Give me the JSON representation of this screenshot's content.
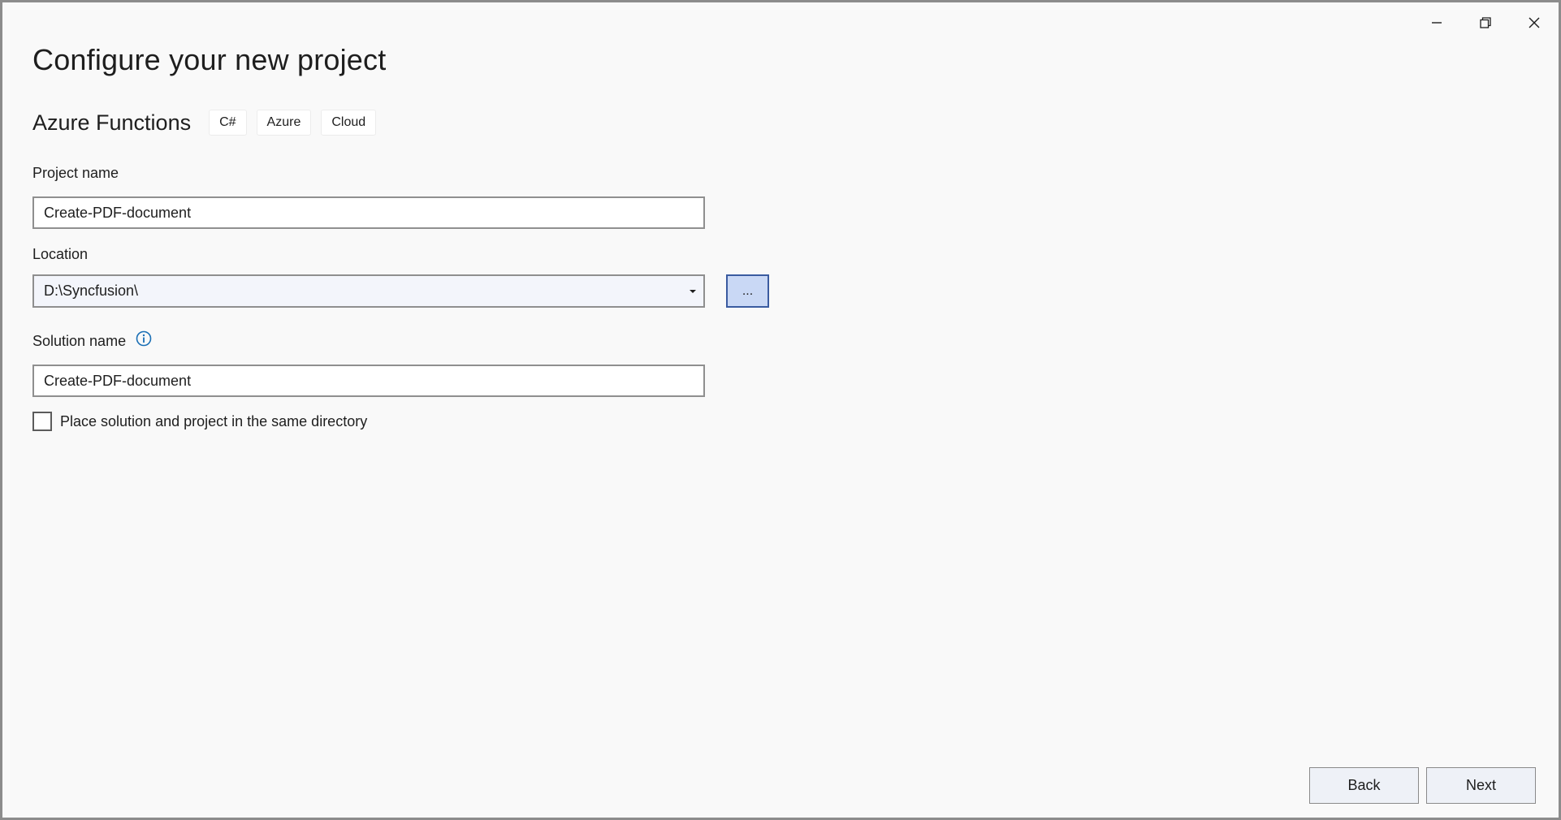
{
  "window": {
    "controls": {
      "minimize_icon": "minimize-icon",
      "maximize_icon": "restore-icon",
      "close_icon": "close-icon"
    }
  },
  "page": {
    "title": "Configure your new project"
  },
  "template": {
    "name": "Azure Functions",
    "tags": [
      "C#",
      "Azure",
      "Cloud"
    ]
  },
  "form": {
    "project_name": {
      "label": "Project name",
      "value": "Create-PDF-document"
    },
    "location": {
      "label": "Location",
      "value": "D:\\Syncfusion\\",
      "browse_label": "..."
    },
    "solution_name": {
      "label": "Solution name",
      "value": "Create-PDF-document",
      "info_icon": "info-icon"
    },
    "same_directory": {
      "label": "Place solution and project in the same directory",
      "checked": false
    }
  },
  "footer": {
    "back_label": "Back",
    "next_label": "Next"
  },
  "colors": {
    "background": "#f9f9f9",
    "accent": "#3a5ba0",
    "browse_fill": "#c9d8f5",
    "info": "#1a6fb5"
  }
}
